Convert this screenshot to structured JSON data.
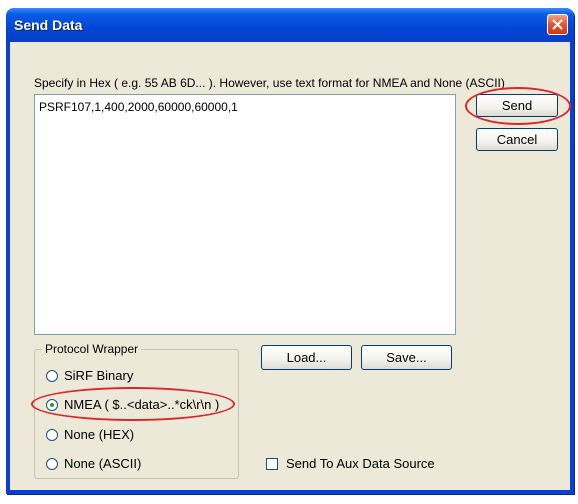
{
  "window": {
    "title": "Send Data"
  },
  "instructions": "Specify in Hex ( e.g. 55 AB 6D... ).  However, use text format for NMEA and None (ASCII)",
  "data_input": {
    "value": "PSRF107,1,400,2000,60000,60000,1"
  },
  "buttons": {
    "send": "Send",
    "cancel": "Cancel",
    "load": "Load...",
    "save": "Save..."
  },
  "protocol_wrapper": {
    "label": "Protocol Wrapper",
    "options": [
      {
        "label": "SiRF Binary",
        "selected": false
      },
      {
        "label": "NMEA ( $..<data>..*ck\\r\\n )",
        "selected": true
      },
      {
        "label": "None (HEX)",
        "selected": false
      },
      {
        "label": "None (ASCII)",
        "selected": false
      }
    ]
  },
  "aux_checkbox": {
    "label": "Send To Aux Data Source",
    "checked": false
  },
  "colors": {
    "title_bar": "#0348d8",
    "dialog_bg": "#ece9d8",
    "highlight_oval": "#d8282a",
    "close_button": "#e0552d"
  }
}
